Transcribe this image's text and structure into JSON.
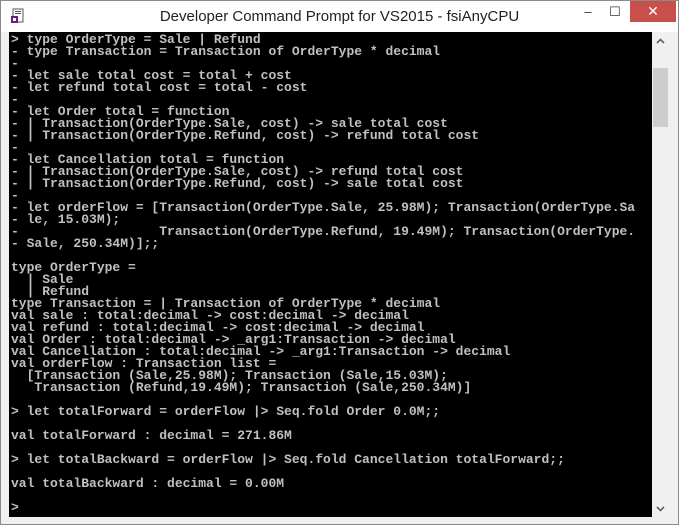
{
  "window": {
    "title": "Developer Command Prompt for VS2015 - fsiAnyCPU",
    "controls": {
      "minimize": "–",
      "maximize": "☐",
      "close": "✕"
    },
    "icon": "visual-studio-prompt-icon"
  },
  "console": {
    "lines": [
      "> type OrderType = Sale | Refund",
      "- type Transaction = Transaction of OrderType * decimal",
      "-",
      "- let sale total cost = total + cost",
      "- let refund total cost = total - cost",
      "-",
      "- let Order total = function",
      "- | Transaction(OrderType.Sale, cost) -> sale total cost",
      "- | Transaction(OrderType.Refund, cost) -> refund total cost",
      "-",
      "- let Cancellation total = function",
      "- | Transaction(OrderType.Sale, cost) -> refund total cost",
      "- | Transaction(OrderType.Refund, cost) -> sale total cost",
      "-",
      "- let orderFlow = [Transaction(OrderType.Sale, 25.98M); Transaction(OrderType.Sa",
      "- le, 15.03M);",
      "-                  Transaction(OrderType.Refund, 19.49M); Transaction(OrderType.",
      "- Sale, 250.34M)];;",
      "",
      "type OrderType =",
      "  | Sale",
      "  | Refund",
      "type Transaction = | Transaction of OrderType * decimal",
      "val sale : total:decimal -> cost:decimal -> decimal",
      "val refund : total:decimal -> cost:decimal -> decimal",
      "val Order : total:decimal -> _arg1:Transaction -> decimal",
      "val Cancellation : total:decimal -> _arg1:Transaction -> decimal",
      "val orderFlow : Transaction list =",
      "  [Transaction (Sale,25.98M); Transaction (Sale,15.03M);",
      "   Transaction (Refund,19.49M); Transaction (Sale,250.34M)]",
      "",
      "> let totalForward = orderFlow |> Seq.fold Order 0.0M;;",
      "",
      "val totalForward : decimal = 271.86M",
      "",
      "> let totalBackward = orderFlow |> Seq.fold Cancellation totalForward;;",
      "",
      "val totalBackward : decimal = 0.00M",
      "",
      ">"
    ]
  },
  "scrollbar": {
    "up": "^",
    "down": "v",
    "position_fraction": 0.0
  }
}
